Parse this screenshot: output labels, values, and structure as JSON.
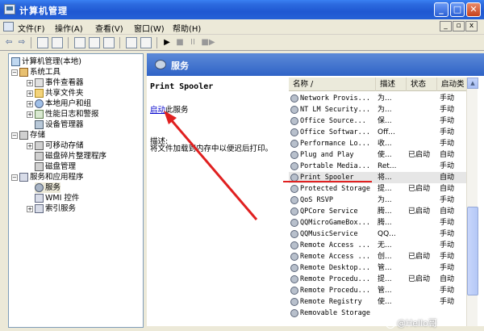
{
  "window": {
    "title": "计算机管理",
    "buttons": {
      "min": "_",
      "max": "□",
      "close": "✕"
    }
  },
  "menu": {
    "items": [
      "文件(F)",
      "操作(A)",
      "查看(V)",
      "窗口(W)",
      "帮助(H)"
    ],
    "mdi": {
      "min": "_",
      "restore": "▫",
      "close": "x"
    }
  },
  "toolbar": {
    "back": "⇦",
    "forward": "⇨",
    "play": "▶",
    "stop": "■",
    "pause": "II",
    "restart": "■▶"
  },
  "tree": {
    "items": [
      {
        "label": "计算机管理(本地)",
        "pm": "",
        "icon": "computer-icon"
      },
      {
        "label": "系统工具",
        "pm": "−",
        "icon": "tools-icon"
      },
      {
        "label": "事件查看器",
        "pm": "+",
        "icon": "event-viewer-icon"
      },
      {
        "label": "共享文件夹",
        "pm": "+",
        "icon": "shared-folder-icon"
      },
      {
        "label": "本地用户和组",
        "pm": "+",
        "icon": "users-icon"
      },
      {
        "label": "性能日志和警报",
        "pm": "+",
        "icon": "performance-icon"
      },
      {
        "label": "设备管理器",
        "pm": "",
        "icon": "device-manager-icon"
      },
      {
        "label": "存储",
        "pm": "−",
        "icon": "storage-icon"
      },
      {
        "label": "可移动存储",
        "pm": "+",
        "icon": "removable-storage-icon"
      },
      {
        "label": "磁盘碎片整理程序",
        "pm": "",
        "icon": "defrag-icon"
      },
      {
        "label": "磁盘管理",
        "pm": "",
        "icon": "disk-management-icon"
      },
      {
        "label": "服务和应用程序",
        "pm": "−",
        "icon": "services-apps-icon"
      },
      {
        "label": "服务",
        "pm": "",
        "icon": "services-icon"
      },
      {
        "label": "WMI 控件",
        "pm": "",
        "icon": "wmi-icon"
      },
      {
        "label": "索引服务",
        "pm": "+",
        "icon": "indexing-icon"
      }
    ]
  },
  "pane": {
    "header": "服务",
    "service_name": "Print Spooler",
    "start_link": "启动",
    "start_suffix": "此服务",
    "desc_label": "描述:",
    "desc_text": "将文件加载到内存中以便迟后打印。"
  },
  "list": {
    "headers": [
      "名称 /",
      "描述",
      "状态",
      "启动类"
    ],
    "rows": [
      {
        "name": "Network Provis...",
        "desc": "为...",
        "status": "",
        "start": "手动"
      },
      {
        "name": "NT LM Security...",
        "desc": "为...",
        "status": "",
        "start": "手动"
      },
      {
        "name": "Office  Source...",
        "desc": "保...",
        "status": "",
        "start": "手动"
      },
      {
        "name": "Office Softwar...",
        "desc": "Off...",
        "status": "",
        "start": "手动"
      },
      {
        "name": "Performance Lo...",
        "desc": "收...",
        "status": "",
        "start": "手动"
      },
      {
        "name": "Plug and Play",
        "desc": "使...",
        "status": "已启动",
        "start": "自动"
      },
      {
        "name": "Portable Media...",
        "desc": "Ret...",
        "status": "",
        "start": "手动"
      },
      {
        "name": "Print Spooler",
        "desc": "将...",
        "status": "",
        "start": "自动"
      },
      {
        "name": "Protected Storage",
        "desc": "提...",
        "status": "已启动",
        "start": "自动"
      },
      {
        "name": "QoS RSVP",
        "desc": "为...",
        "status": "",
        "start": "手动"
      },
      {
        "name": "QPCore Service",
        "desc": "腾...",
        "status": "已启动",
        "start": "自动"
      },
      {
        "name": "QQMicroGameBox...",
        "desc": "腾...",
        "status": "",
        "start": "手动"
      },
      {
        "name": "QQMusicService",
        "desc": "QQ...",
        "status": "",
        "start": "手动"
      },
      {
        "name": "Remote Access ...",
        "desc": "无...",
        "status": "",
        "start": "手动"
      },
      {
        "name": "Remote Access ...",
        "desc": "创...",
        "status": "已启动",
        "start": "手动"
      },
      {
        "name": "Remote Desktop...",
        "desc": "管...",
        "status": "",
        "start": "手动"
      },
      {
        "name": "Remote Procedu...",
        "desc": "提...",
        "status": "已启动",
        "start": "自动"
      },
      {
        "name": "Remote Procedu...",
        "desc": "管...",
        "status": "",
        "start": "手动"
      },
      {
        "name": "Remote Registry",
        "desc": "使...",
        "status": "",
        "start": "手动"
      },
      {
        "name": "Removable Storage",
        "desc": "",
        "status": "",
        "start": ""
      }
    ],
    "selected_index": 7
  },
  "scroll": {
    "up": "▲"
  },
  "watermark": "@Hello哥",
  "colors": {
    "annotation_red": "#e02020",
    "title_blue": "#2561d6"
  }
}
